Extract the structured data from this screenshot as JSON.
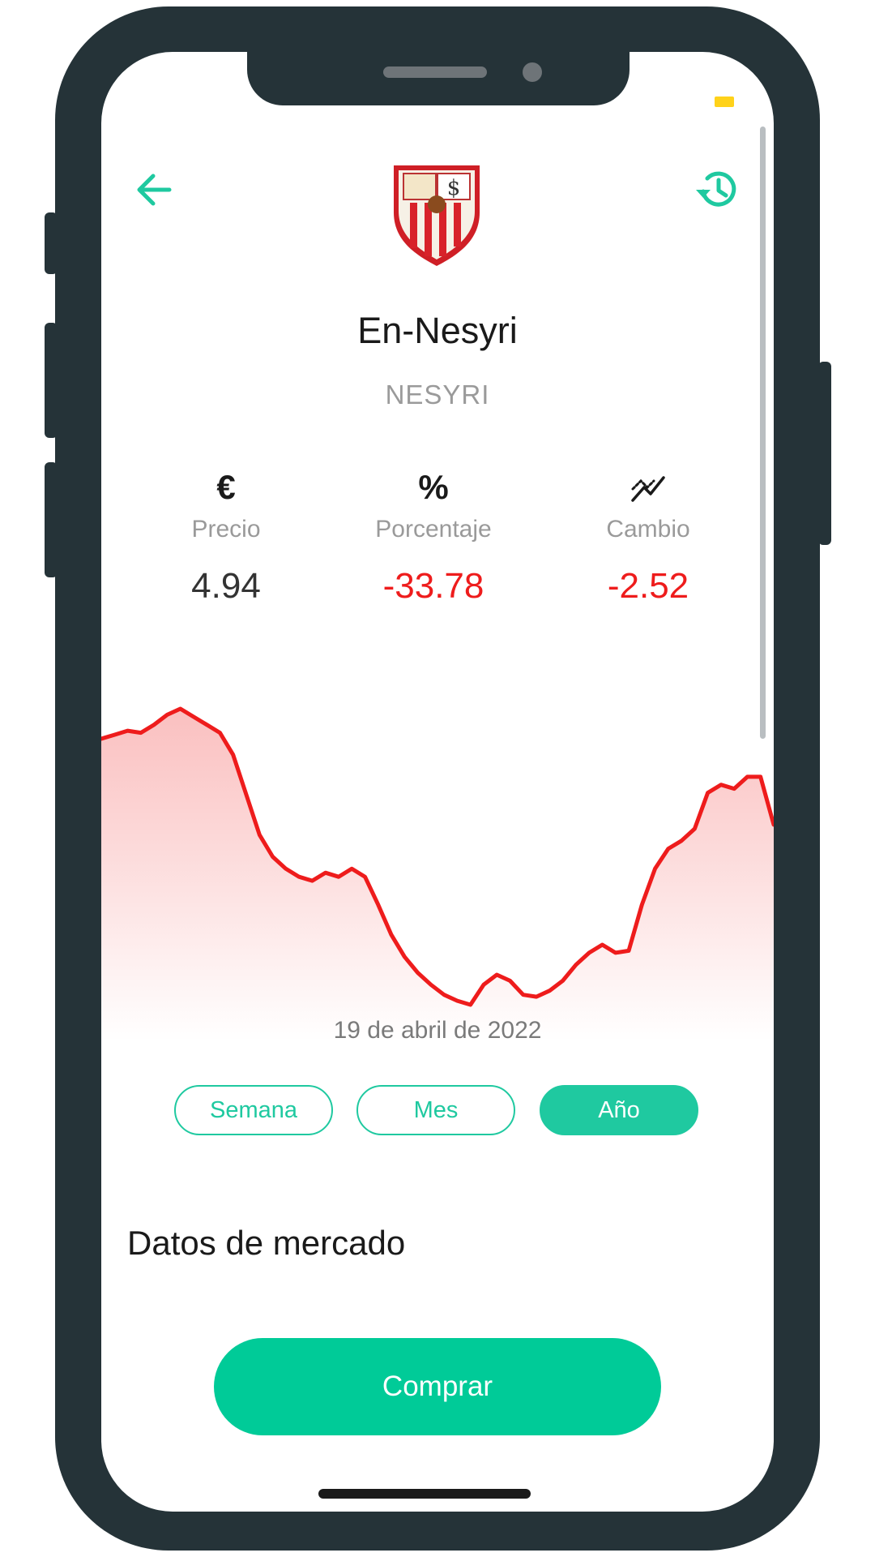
{
  "colors": {
    "accent": "#00cb98",
    "negative": "#ee1c1c",
    "frame": "#253338"
  },
  "header": {
    "back_icon": "arrow-left-icon",
    "history_icon": "history-clock-icon",
    "crest": "sevilla-fc-crest"
  },
  "player": {
    "name": "En-Nesyri",
    "ticker": "NESYRI"
  },
  "stats": [
    {
      "icon": "euro-icon",
      "symbol": "€",
      "label": "Precio",
      "value": "4.94",
      "color": "#333333"
    },
    {
      "icon": "percent-icon",
      "symbol": "%",
      "label": "Porcentaje",
      "value": "-33.78",
      "color": "#ee1c1c"
    },
    {
      "icon": "trend-chart-icon",
      "symbol": "",
      "label": "Cambio",
      "value": "-2.52",
      "color": "#ee1c1c"
    }
  ],
  "chart_data": {
    "type": "area",
    "title": "",
    "xlabel": "",
    "ylabel": "",
    "grid": false,
    "line_color": "#ee1c1c",
    "series": [
      {
        "values": [
          73,
          75,
          77,
          76,
          80,
          85,
          88,
          84,
          80,
          76,
          65,
          45,
          25,
          14,
          8,
          4,
          2,
          6,
          4,
          8,
          4,
          -10,
          -25,
          -36,
          -44,
          -50,
          -55,
          -58,
          -60,
          -50,
          -45,
          -48,
          -55,
          -56,
          -53,
          -48,
          -40,
          -34,
          -30,
          -34,
          -33,
          -10,
          8,
          18,
          22,
          28,
          46,
          50,
          48,
          54,
          54,
          30
        ]
      }
    ]
  },
  "date": "19 de abril de 2022",
  "ranges": [
    {
      "label": "Semana",
      "active": false
    },
    {
      "label": "Mes",
      "active": false
    },
    {
      "label": "Año",
      "active": true
    }
  ],
  "market_section_title": "Datos de mercado",
  "buy_button_label": "Comprar"
}
